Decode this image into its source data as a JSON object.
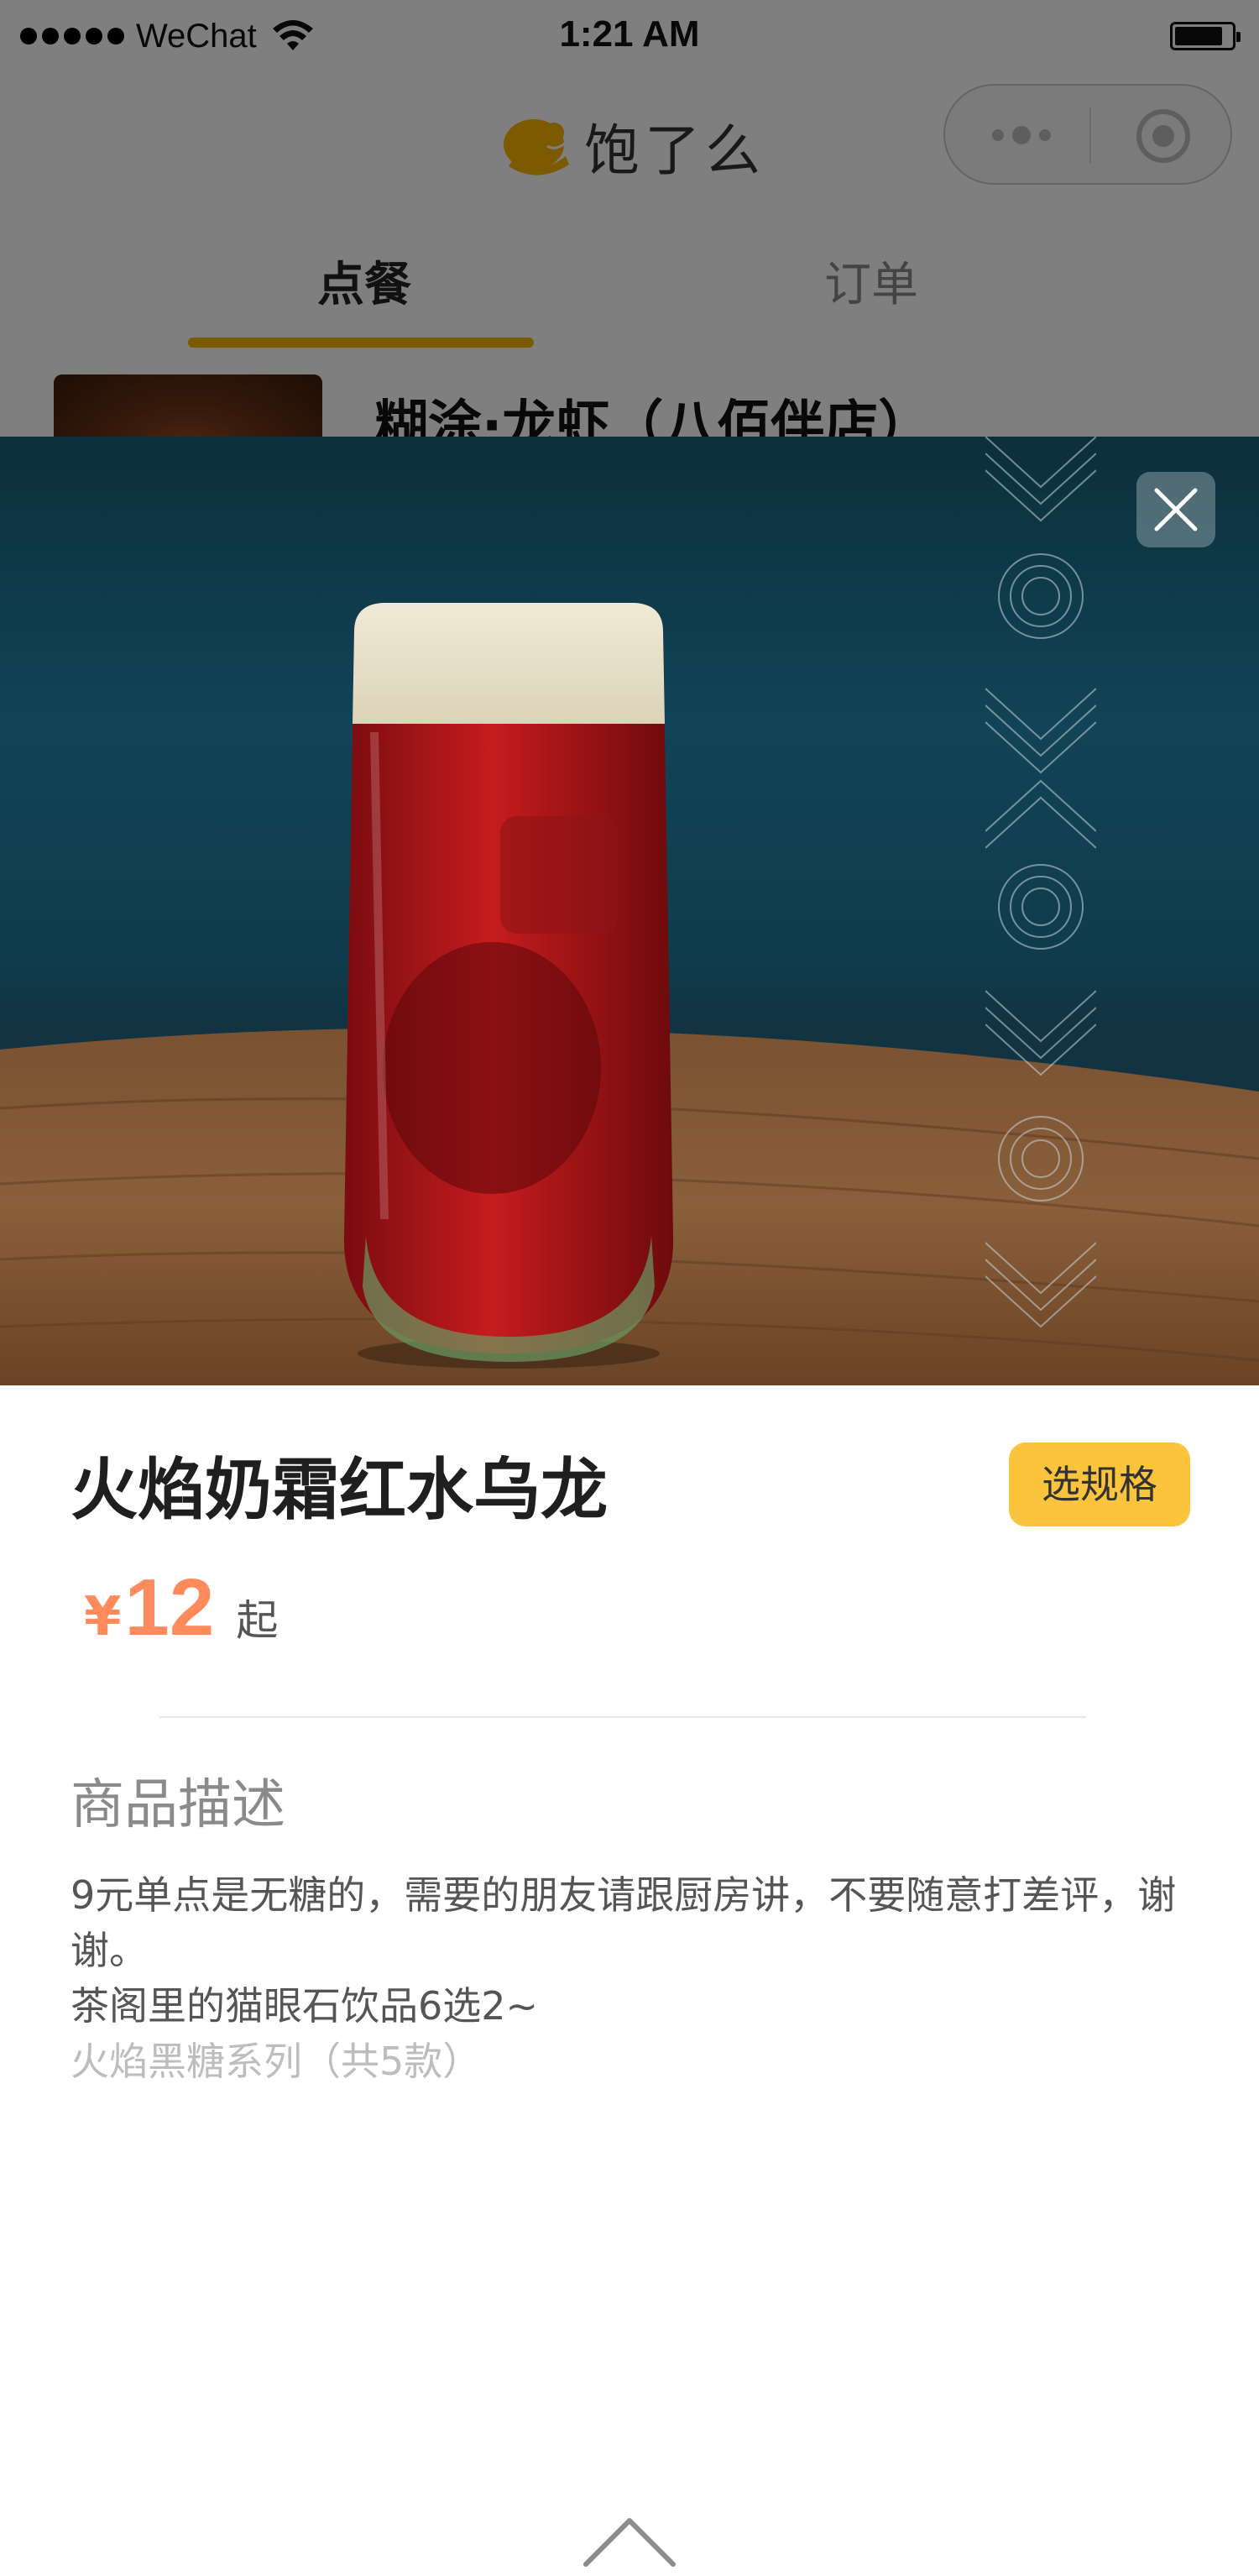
{
  "status_bar": {
    "carrier": "WeChat",
    "time": "1:21 AM"
  },
  "header": {
    "app_name": "饱了么",
    "icons": [
      "brand-logo-icon",
      "more-dots-icon",
      "target-icon"
    ]
  },
  "tabs": [
    {
      "label": "点餐",
      "active": true
    },
    {
      "label": "订单",
      "active": false
    }
  ],
  "shop": {
    "name": "糊涂·龙虾（八佰伴店）"
  },
  "colors": {
    "accent": "#f6b400",
    "spec_button": "#fcc43d",
    "price": "#ff8a5c",
    "overlay": "rgba(0,0,0,0.5)"
  },
  "product": {
    "name": "火焰奶霜红水乌龙",
    "spec_button_label": "选规格",
    "price_currency": "¥",
    "price_value": "12",
    "price_suffix": "起",
    "description_title": "商品描述",
    "description_lines": [
      "9元单点是无糖的，需要的朋友请跟厨房讲，不要随意打差评，谢谢。",
      "茶阁里的猫眼石饮品6选2~",
      "火焰黑糖系列（共5款）"
    ],
    "close_icon": "close-icon",
    "expand_icon": "chevron-up-icon"
  }
}
